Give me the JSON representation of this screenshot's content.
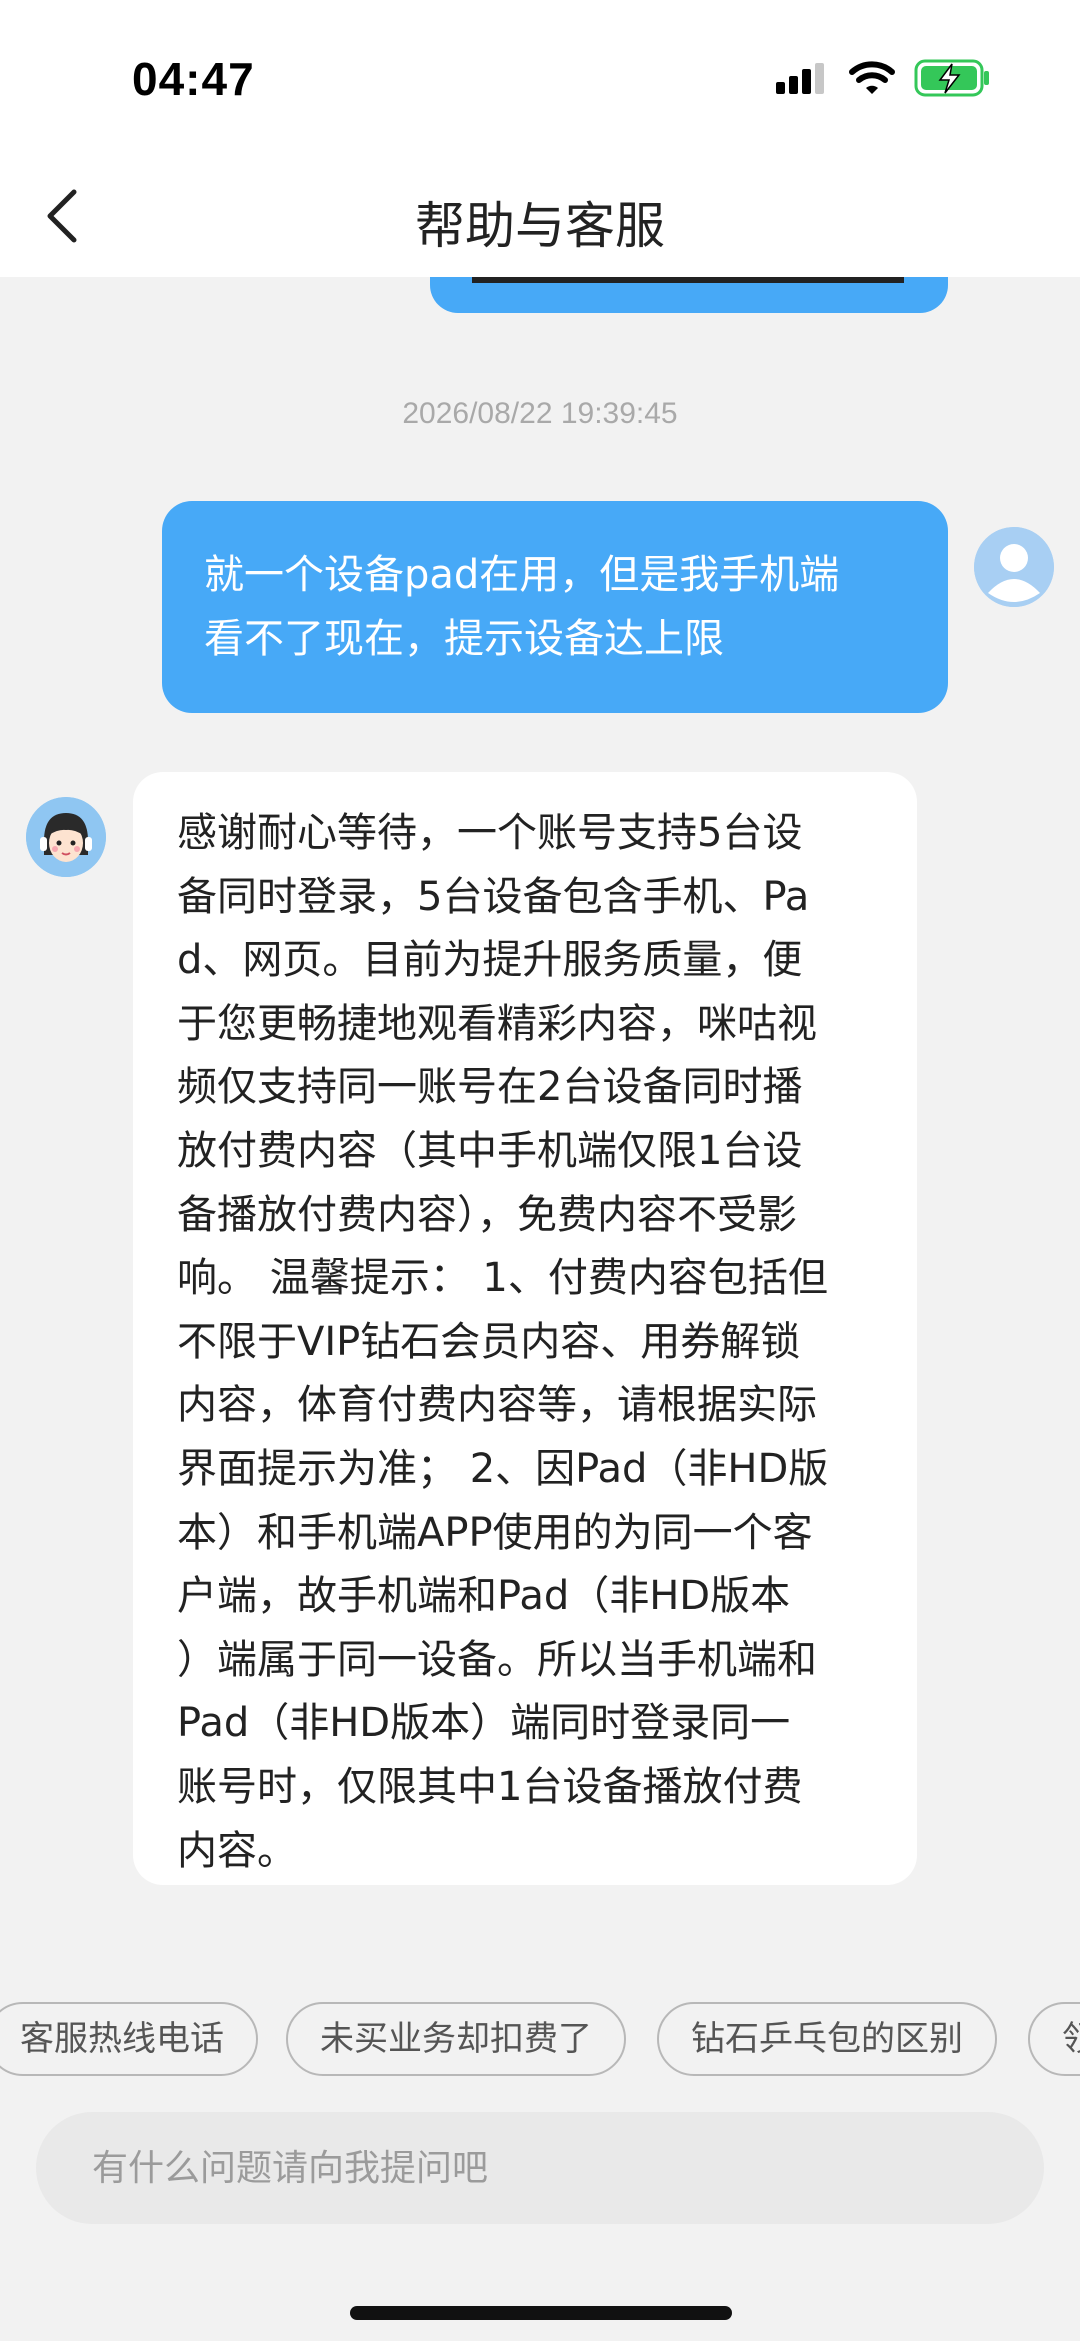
{
  "status_bar": {
    "time": "04:47",
    "signal_icon": "cellular-signal-icon",
    "wifi_icon": "wifi-icon",
    "battery_icon": "battery-charging-icon",
    "battery_color": "#34c759"
  },
  "header": {
    "title": "帮助与客服",
    "back_icon": "chevron-left-icon"
  },
  "chat": {
    "timestamp": "2026/08/22 19:39:45",
    "messages": [
      {
        "sender": "user",
        "lines": [
          "就一个设备pad在用，但是我手机端",
          "看不了现在，提示设备达上限"
        ]
      },
      {
        "sender": "agent",
        "lines": [
          "感谢耐心等待，一个账号支持5台设",
          "备同时登录，5台设备包含手机、Pa",
          "d、网页。目前为提升服务质量，便",
          "于您更畅捷地观看精彩内容，咪咕视",
          "频仅支持同一账号在2台设备同时播",
          "放付费内容（其中手机端仅限1台设",
          "备播放付费内容），免费内容不受影",
          "响。 温馨提示： 1、付费内容包括但",
          "不限于VIP钻石会员内容、用券解锁",
          "内容，体育付费内容等，请根据实际",
          "界面提示为准； 2、因Pad（非HD版",
          "本）和手机端APP使用的为同一个客",
          "户端，故手机端和Pad（非HD版本",
          "）端属于同一设备。所以当手机端和",
          "Pad（非HD版本）端同时登录同一",
          "账号时，仅限其中1台设备播放付费",
          "内容。"
        ]
      }
    ]
  },
  "quick_replies": [
    "客服热线电话",
    "未买业务却扣费了",
    "钻石乒乓包的区别",
    "领"
  ],
  "input": {
    "placeholder": "有什么问题请向我提问吧",
    "value": ""
  },
  "colors": {
    "user_bubble": "#47a9f7",
    "background": "#f2f2f2"
  }
}
